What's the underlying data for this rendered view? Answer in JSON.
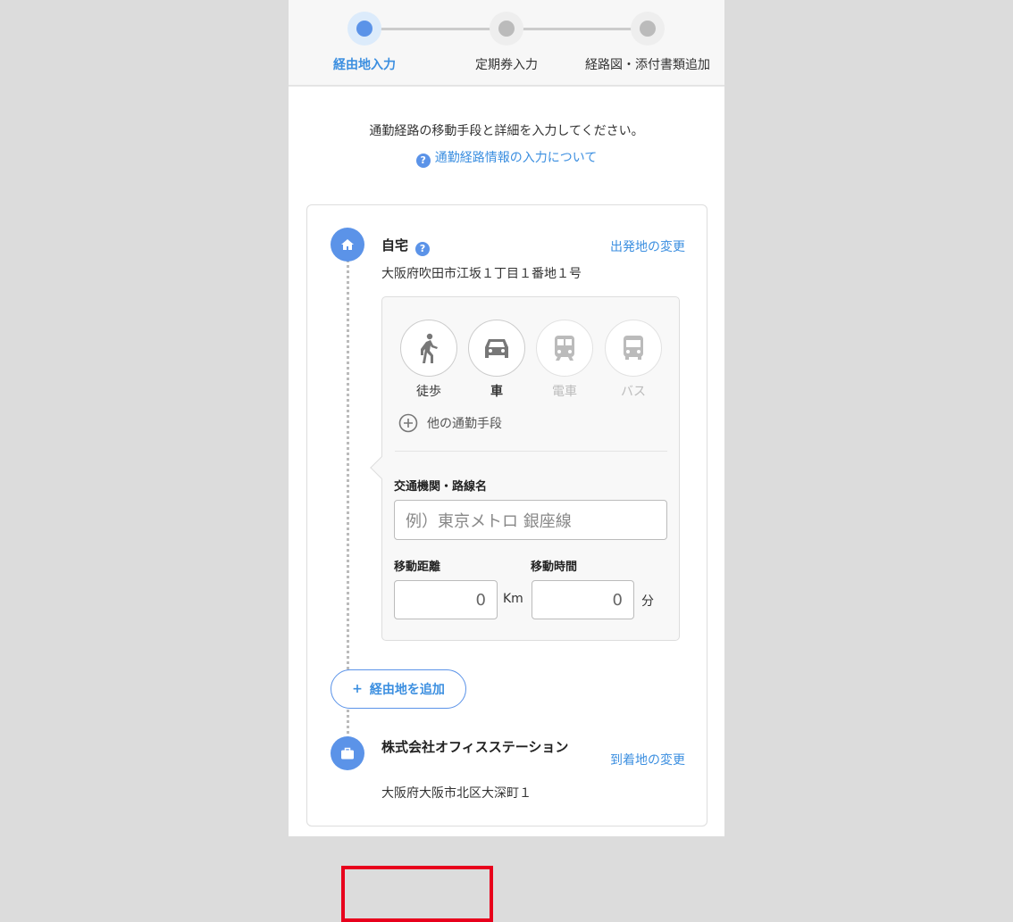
{
  "stepper": {
    "steps": [
      {
        "label": "経由地入力",
        "state": "active"
      },
      {
        "label": "定期券入力",
        "state": "inactive"
      },
      {
        "label": "経路図・添付書類追加",
        "state": "inactive"
      }
    ]
  },
  "intro": {
    "text": "通勤経路の移動手段と詳細を入力してください。",
    "help_link": "通勤経路情報の入力について"
  },
  "origin": {
    "name": "自宅",
    "address": "大阪府吹田市江坂１丁目１番地１号",
    "change_link": "出発地の変更"
  },
  "segment": {
    "modes": [
      {
        "label": "徒歩",
        "enabled": true
      },
      {
        "label": "車",
        "enabled": true
      },
      {
        "label": "電車",
        "enabled": false
      },
      {
        "label": "バス",
        "enabled": false
      }
    ],
    "other_modes": "他の通勤手段",
    "route_label": "交通機関・路線名",
    "route_placeholder": "例）東京メトロ 銀座線",
    "distance_label": "移動距離",
    "distance_value": "0",
    "distance_unit": "Km",
    "time_label": "移動時間",
    "time_value": "0",
    "time_unit": "分"
  },
  "add_waypoint": "経由地を追加",
  "destination": {
    "name": "株式会社オフィスステーション",
    "address": "大阪府大阪市北区大深町１",
    "change_link": "到着地の変更"
  },
  "colors": {
    "accent": "#5b93e8",
    "link": "#3c8fe0",
    "highlight": "#e8001c"
  }
}
